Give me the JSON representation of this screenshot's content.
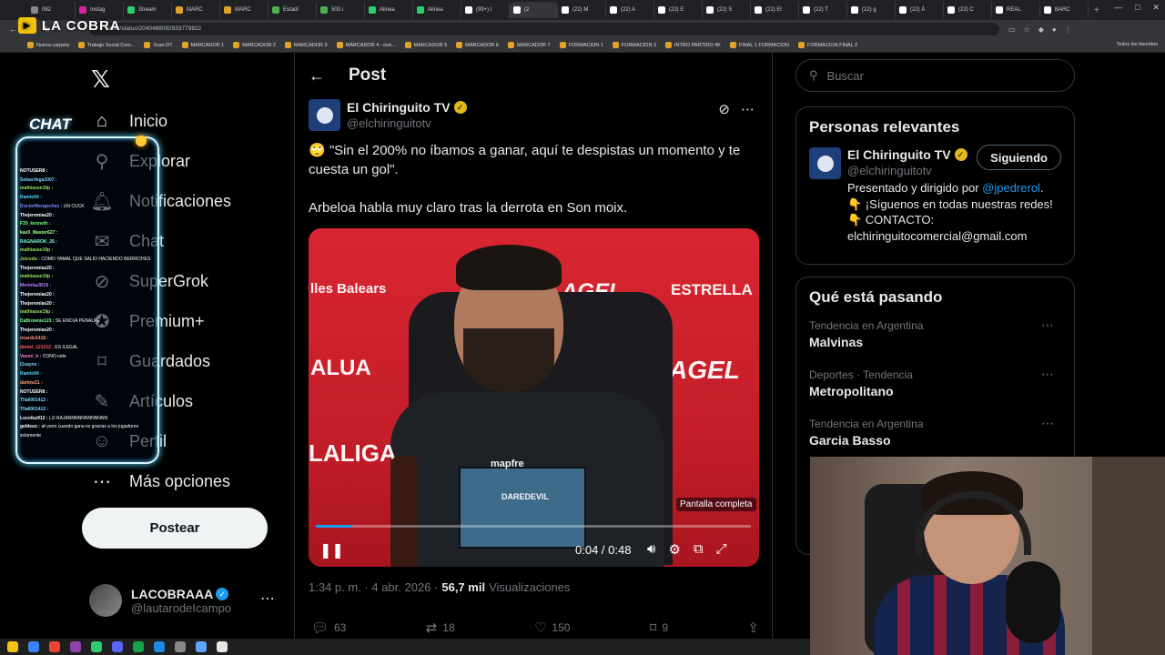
{
  "browser": {
    "tabs": [
      {
        "label": "082",
        "color": "#888888"
      },
      {
        "label": "Instag",
        "color": "#d6249f"
      },
      {
        "label": "Stream",
        "color": "#2ecc71"
      },
      {
        "label": "MARC",
        "color": "#e0a22a"
      },
      {
        "label": "MARC",
        "color": "#e0a22a"
      },
      {
        "label": "Estadí",
        "color": "#4caf50"
      },
      {
        "label": "500.i",
        "color": "#4caf50"
      },
      {
        "label": "Alinea",
        "color": "#2ecc71"
      },
      {
        "label": "Alinea",
        "color": "#2ecc71"
      },
      {
        "label": "(99+) l",
        "color": "#ffffff"
      },
      {
        "label": "(2",
        "color": "#ffffff",
        "active": true
      },
      {
        "label": "(22) M",
        "color": "#ffffff"
      },
      {
        "label": "(22) A",
        "color": "#ffffff"
      },
      {
        "label": "(22) E",
        "color": "#ffffff"
      },
      {
        "label": "(22) S",
        "color": "#ffffff"
      },
      {
        "label": "(22) El",
        "color": "#ffffff"
      },
      {
        "label": "(22) T",
        "color": "#ffffff"
      },
      {
        "label": "(22) g",
        "color": "#ffffff"
      },
      {
        "label": "(22) À",
        "color": "#ffffff"
      },
      {
        "label": "(22) C",
        "color": "#ffffff"
      },
      {
        "label": "REAL",
        "color": "#ffffff"
      },
      {
        "label": "BARC",
        "color": "#ffffff"
      }
    ],
    "url": "uitotv/status/2040468092933779822",
    "overlay_logo": "LA COBRA",
    "bookmarks": [
      "Nueva carpeta",
      "Trabajo Social Com...",
      "Gran DT",
      "MARCADOR 1",
      "MARCADOR 2",
      "MARCADOR 3",
      "MARCADOR 4 - ove...",
      "MARCADOR 5",
      "MARCADOR 6",
      "MARCADOR 7",
      "FORMACION 1",
      "FORMACION 2",
      "INTRO PARTIDO 4K",
      "FINAL 1 FORMACION",
      "FORMACION FINAL 2"
    ],
    "bookmarks_right": "Todos los favoritos"
  },
  "leftnav": {
    "items": [
      {
        "label": "Inicio",
        "icon": "home-icon",
        "glyph": "⌂"
      },
      {
        "label": "Explorar",
        "icon": "search-icon",
        "glyph": "⚲"
      },
      {
        "label": "Notificaciones",
        "icon": "bell-icon",
        "glyph": "🔔︎"
      },
      {
        "label": "Chat",
        "icon": "chat-icon",
        "glyph": "✉"
      },
      {
        "label": "SuperGrok",
        "icon": "grok-icon",
        "glyph": "⊘"
      },
      {
        "label": "Premium+",
        "icon": "premium-icon",
        "glyph": "✪"
      },
      {
        "label": "Guardados",
        "icon": "bookmark-icon",
        "glyph": "⌑"
      },
      {
        "label": "Artículos",
        "icon": "article-icon",
        "glyph": "✎"
      },
      {
        "label": "Perfil",
        "icon": "profile-icon",
        "glyph": "☺"
      },
      {
        "label": "Más opciones",
        "icon": "more-icon",
        "glyph": "⋯"
      }
    ],
    "post_button": "Postear",
    "account": {
      "name": "LACOBRAAA",
      "handle": "@lautarodeIcampo"
    }
  },
  "chat_overlay": {
    "title": "CHAT",
    "lines": [
      {
        "user": "NOTUSER8 :",
        "msg": "",
        "color": "#ffffff"
      },
      {
        "user": "SebasVega1007 :",
        "msg": "",
        "color": "#7cd5ff"
      },
      {
        "user": "mathiasse19p :",
        "msg": "",
        "color": "#9be15d"
      },
      {
        "user": "Ramio04 :",
        "msg": "",
        "color": "#5dd4ff"
      },
      {
        "user": "DoctorMengeches :",
        "msg": "UN CUCK",
        "color": "#7c8cff"
      },
      {
        "user": "Thejeremias20 :",
        "msg": "",
        "color": "#ffffff"
      },
      {
        "user": "F35_kenneth :",
        "msg": "",
        "color": "#7cff8a"
      },
      {
        "user": "kas9_Master627 :",
        "msg": "",
        "color": "#a3ff7c"
      },
      {
        "user": "RAGNAROK_26 :",
        "msg": "",
        "color": "#7cffd5"
      },
      {
        "user": "mathiasse19p :",
        "msg": "",
        "color": "#9be15d"
      },
      {
        "user": "Joicvdo :",
        "msg": "COMO YAMAL QUE SALIO HACIENDO BERRICHES",
        "color": "#9be15d"
      },
      {
        "user": "Thejeremias20 :",
        "msg": "",
        "color": "#ffffff"
      },
      {
        "user": "mathiasse19p :",
        "msg": "",
        "color": "#9be15d"
      },
      {
        "user": "MerinbaJR19 :",
        "msg": "",
        "color": "#c77cff"
      },
      {
        "user": "Thejeremias20 :",
        "msg": "",
        "color": "#ffffff"
      },
      {
        "user": "Thejeremias20 :",
        "msg": "",
        "color": "#ffffff"
      },
      {
        "user": "mathiasse19p :",
        "msg": "",
        "color": "#9be15d"
      },
      {
        "user": "DaBrownie123 :",
        "msg": "SE ENOJA PENALPE",
        "color": "#7cff8a"
      },
      {
        "user": "Thejeremias20 :",
        "msg": "",
        "color": "#ffffff"
      },
      {
        "user": "ricardo1418 :",
        "msg": "",
        "color": "#ff9a7c"
      },
      {
        "user": "daniel_121212 :",
        "msg": "ES ILEGAL",
        "color": "#ff5c5c"
      },
      {
        "user": "Vasmi_h :",
        "msg": "CONO-cido",
        "color": "#ff7cc8"
      },
      {
        "user": "l2sayne :",
        "msg": "",
        "color": "#7cd5ff"
      },
      {
        "user": "Ramio04 :",
        "msg": "",
        "color": "#5dd4ff"
      },
      {
        "user": "darlow21 :",
        "msg": "",
        "color": "#ffa07c"
      },
      {
        "user": "NOTUSER8 :",
        "msg": "",
        "color": "#ffffff"
      },
      {
        "user": "Tlla6001412 :",
        "msg": "",
        "color": "#7cd5ff"
      },
      {
        "user": "Tlla6001412 :",
        "msg": "",
        "color": "#7cd5ff"
      },
      {
        "user": "Locofuz912 :",
        "msg": "LO RAJANNNNNNNNNNNN",
        "color": "#ffffff"
      },
      {
        "user": "gebleso :",
        "msg": "ah pero cuando gana es gracias a los jugadores",
        "color": "#ffffff"
      },
      {
        "user": "",
        "msg": "solamente",
        "color": "#ffffff"
      }
    ]
  },
  "post": {
    "header": "Post",
    "author": {
      "name": "El Chiringuito TV",
      "handle": "@elchiringuitotv"
    },
    "text_line1": "🙄 \"Sin el 200% no íbamos a ganar, aquí te despistas un momento y te cuesta un gol\".",
    "text_line2": "Arbeloa habla muy claro tras la derrota en Son moix.",
    "video": {
      "fullscreen_tip": "Pantalla completa",
      "time": "0:04 / 0:48",
      "progress": 0.083,
      "backdrop_words": [
        "lles Balears",
        "AGEL",
        "ESTRELLA",
        "ALUA",
        "AGEL",
        "LALIGA",
        "mapfre",
        "DAREDEVIL"
      ]
    },
    "meta": {
      "time": "1:34 p. m. · 4 abr. 2026 ·",
      "views": "56,7 mil",
      "views_label": "Visualizaciones"
    },
    "actions": {
      "replies": "63",
      "reposts": "18",
      "likes": "150",
      "bookmarks": "9"
    }
  },
  "right": {
    "search_placeholder": "Buscar",
    "relevant": {
      "title": "Personas relevantes",
      "name": "El Chiringuito TV",
      "handle": "@elchiringuitotv",
      "follow_label": "Siguiendo",
      "bio_prefix": "Presentado y dirigido por ",
      "bio_link": "@jpedrerol",
      "bio_suffix": ".",
      "bio_line2": "👇 ¡Síguenos en todas nuestras redes!",
      "bio_line3": "👇 CONTACTO:",
      "bio_line4": "elchiringuitocomercial@gmail.com"
    },
    "trends": {
      "title": "Qué está pasando",
      "items": [
        {
          "context": "Tendencia en Argentina",
          "name": "Malvinas"
        },
        {
          "context": "Deportes · Tendencia",
          "name": "Metropolitano"
        },
        {
          "context": "Tendencia en Argentina",
          "name": "Garcia Basso"
        }
      ]
    }
  },
  "taskbar": {
    "icons": [
      "#f2c40f",
      "#3b82f6",
      "#ea4335",
      "#8e44ad",
      "#2ecc71",
      "#5865f2",
      "#16a34a",
      "#1e88e5",
      "#888888",
      "#60a5fa",
      "#e5e7eb"
    ]
  }
}
